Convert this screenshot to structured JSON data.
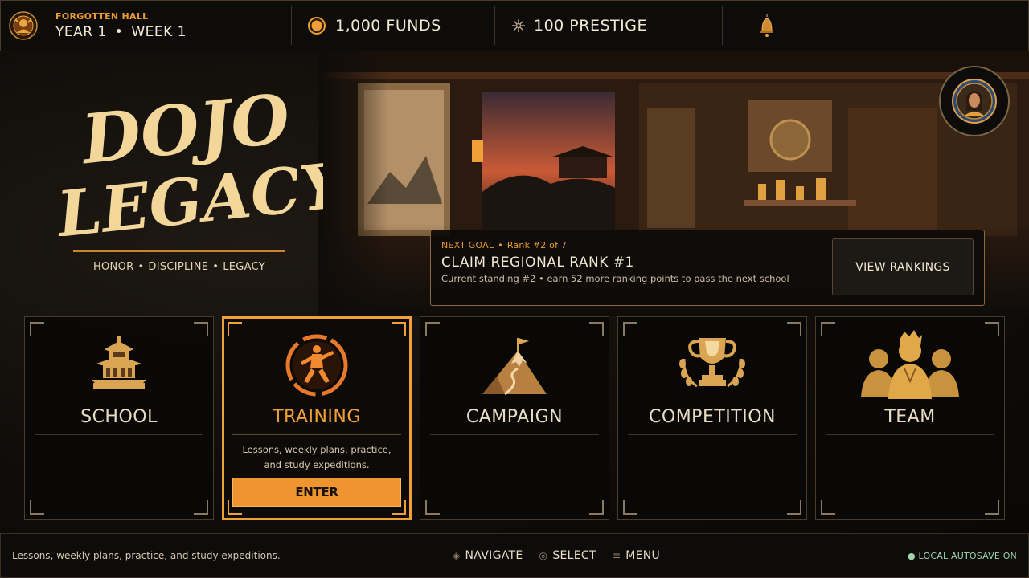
{
  "header": {
    "hall_name": "FORGOTTEN HALL",
    "year": "YEAR 1",
    "date_sep": "•",
    "week": "WEEK 1",
    "funds": "1,000 FUNDS",
    "prestige": "100 PRESTIGE"
  },
  "hero": {
    "logo_line1": "DOJO",
    "logo_line2": "LEGACY",
    "tagline": [
      "HONOR",
      "DISCIPLINE",
      "LEGACY"
    ],
    "tagline_sep": "•"
  },
  "goal": {
    "label": "NEXT GOAL",
    "sep": "•",
    "rank": "Rank #2 of 7",
    "title": "CLAIM REGIONAL RANK #1",
    "description": "Current standing #2 • earn 52 more ranking points to pass the next school",
    "button": "VIEW RANKINGS"
  },
  "menu": {
    "cards": [
      {
        "title": "SCHOOL",
        "icon": "pagoda-icon"
      },
      {
        "title": "TRAINING",
        "icon": "fighter-emblem-icon",
        "description": "Lessons, weekly plans, practice, and study expeditions.",
        "action": "ENTER",
        "selected": true
      },
      {
        "title": "CAMPAIGN",
        "icon": "mountain-flag-icon"
      },
      {
        "title": "COMPETITION",
        "icon": "trophy-icon"
      },
      {
        "title": "TEAM",
        "icon": "team-icon"
      }
    ]
  },
  "footer": {
    "hint": "Lessons, weekly plans, practice, and study expeditions.",
    "navigate": "NAVIGATE",
    "select": "SELECT",
    "menu": "MENU",
    "autosave": "● LOCAL AUTOSAVE ON"
  },
  "colors": {
    "accent": "#ee9430",
    "gold": "#e7b25a",
    "text": "#e9dcc4",
    "panel_border": "#8a6a3e",
    "autosave": "#9ed4a8"
  }
}
